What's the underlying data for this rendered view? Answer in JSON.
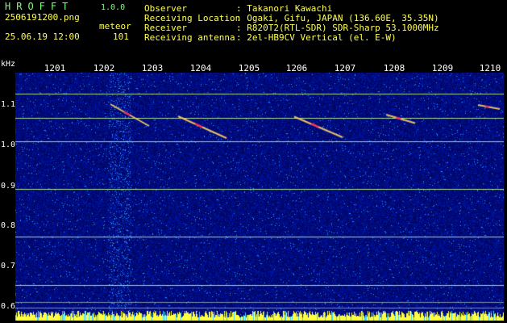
{
  "header": {
    "app_title": "HROFFT",
    "app_version": "1.0.0",
    "filename": "2506191200.png",
    "meteor_label": "meteor",
    "datetime": "25.06.19 12:00",
    "meteor_count": "101",
    "meta": [
      {
        "label": "Observer",
        "value": ": Takanori Kawachi"
      },
      {
        "label": "Receiving Location",
        "value": ": Ogaki, Gifu, JAPAN (136.60E, 35.35N)"
      },
      {
        "label": "Receiver",
        "value": ": R820T2(RTL-SDR) SDR-Sharp 53.1000MHz"
      },
      {
        "label": "Receiving antenna",
        "value": ": 2el-HB9CV Vertical (el. E-W)"
      }
    ]
  },
  "axes": {
    "y_unit": "kHz",
    "x_ticks": [
      "1201",
      "1202",
      "1203",
      "1204",
      "1205",
      "1206",
      "1207",
      "1208",
      "1209",
      "1210"
    ],
    "y_ticks": [
      "1.1",
      "1.0",
      "0.9",
      "0.8",
      "0.7",
      "0.6"
    ]
  },
  "chart_data": {
    "type": "heatmap",
    "x_range": [
      1200.5,
      1210.2
    ],
    "y_range": [
      0.585,
      1.155
    ],
    "x_ticks": [
      1201,
      1202,
      1203,
      1204,
      1205,
      1206,
      1207,
      1208,
      1209,
      1210
    ],
    "y_ticks": [
      1.1,
      1.0,
      0.9,
      0.8,
      0.7,
      0.6
    ],
    "carrier_lines_khz": [
      1.128,
      1.069,
      1.011,
      0.893,
      0.775,
      0.655
    ],
    "meteor_traces": [
      {
        "x": [
          1202.15,
          1202.95
        ],
        "y": [
          1.102,
          1.048
        ]
      },
      {
        "x": [
          1203.55,
          1204.55
        ],
        "y": [
          1.072,
          1.018
        ]
      },
      {
        "x": [
          1205.95,
          1206.95
        ],
        "y": [
          1.071,
          1.02
        ]
      },
      {
        "x": [
          1207.85,
          1208.45
        ],
        "y": [
          1.076,
          1.055
        ]
      },
      {
        "x": [
          1209.75,
          1210.2
        ],
        "y": [
          1.1,
          1.09
        ]
      }
    ],
    "grid": false
  },
  "colors": {
    "background": "#000000",
    "noise_base": "#000c8c",
    "carrier": "#c8ff80",
    "trace": "#ffd060",
    "trace_core": "#ff2050",
    "bottom_bar": "#ffff40",
    "header_text": "#ffff55",
    "title_text": "#7dff7d"
  }
}
